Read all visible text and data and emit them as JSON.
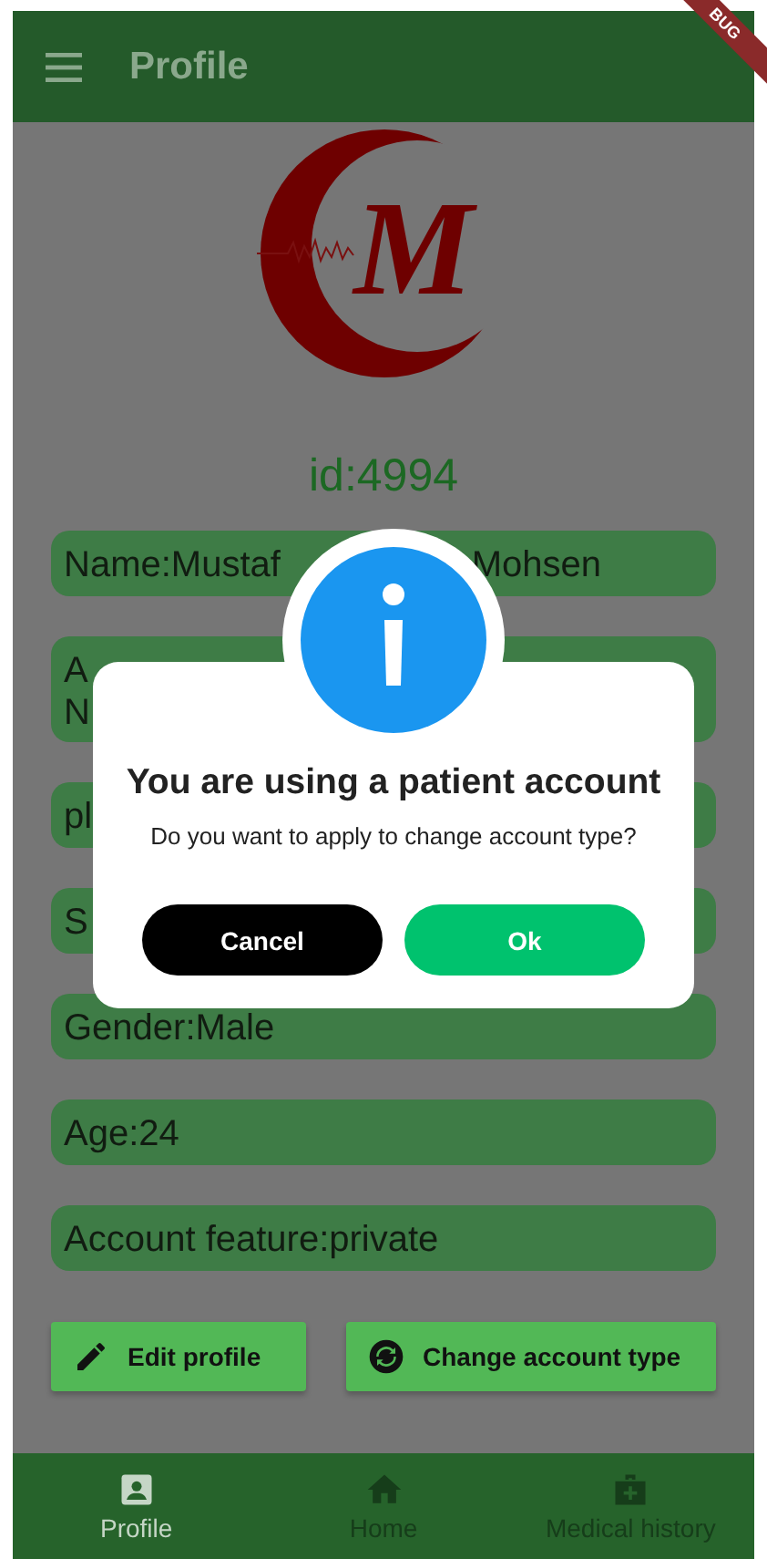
{
  "app_bar": {
    "title": "Profile"
  },
  "debug_banner": "BUG",
  "logo": {
    "letter": "M"
  },
  "user_id": "id:4994",
  "fields": [
    {
      "lines": [
        "Name:Mustaf"
      ],
      "trailing": "Mohsen"
    },
    {
      "lines": [
        "A",
        "N"
      ]
    },
    {
      "lines": [
        "pl"
      ]
    },
    {
      "lines": [
        "S"
      ]
    },
    {
      "lines": [
        "Gender:Male"
      ]
    },
    {
      "lines": [
        "Age:24"
      ]
    },
    {
      "lines": [
        "Account feature:private"
      ]
    }
  ],
  "actions": [
    {
      "label": "Edit profile"
    },
    {
      "label": "Change account type"
    }
  ],
  "dialog": {
    "title": "You are using a patient account",
    "message": "Do you want to apply to change account type?",
    "buttons": [
      {
        "label": "Cancel",
        "kind": "secondary"
      },
      {
        "label": "Ok",
        "kind": "primary"
      }
    ]
  },
  "bottom_nav": [
    {
      "label": "Profile",
      "selected": true
    },
    {
      "label": "Home",
      "selected": false
    },
    {
      "label": "Medical history",
      "selected": false
    }
  ]
}
